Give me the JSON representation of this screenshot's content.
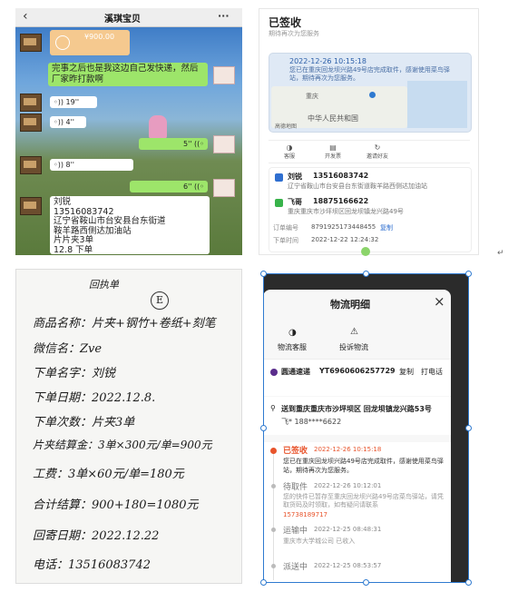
{
  "chat": {
    "title": "溪琪宝贝",
    "back_icon": "‹",
    "more_icon": "···",
    "payment_amount": "¥900.00",
    "msg_text": "完事之后也是我这边自己发快递，然后厂家昨打款啊",
    "voices": [
      {
        "duration": "19''",
        "side": "left"
      },
      {
        "duration": "4''",
        "side": "left"
      },
      {
        "duration": "5''",
        "side": "right"
      },
      {
        "duration": "8''",
        "side": "left"
      },
      {
        "duration": "6''",
        "side": "right"
      }
    ],
    "contact_name": "刘锐",
    "contact_phone": "13516083742",
    "contact_addr1": "辽宁省鞍山市台安县台东街道",
    "contact_addr2": "鞍羊路西侧达加油站",
    "contact_item": "片片夹3单",
    "contact_total": "12.8 下单"
  },
  "logistics": {
    "status": "已签收",
    "status_sub": "期待再次为您服务",
    "event_time": "2022-12-26 10:15:18",
    "event_text": "您已在重庆回龙坝兴路49号店完成取件，感谢使用菜鸟驿站，期待再次为您服务。",
    "map_label1": "重庆",
    "map_label2": "中华人民共和国",
    "map_credit": "高德地图",
    "actions": [
      "客服",
      "开发票",
      "邀请好友"
    ],
    "sender_name": "刘锐",
    "sender_phone": "13516083742",
    "sender_addr": "辽宁省鞍山市台安县台东街道鞍羊路西侧达加油站",
    "receiver_name": "飞哥",
    "receiver_phone": "18875166622",
    "receiver_addr": "重庆重庆市沙坪坝区回龙坝镇龙兴路49号",
    "order_label": "订单编号",
    "order_no": "8791925173448455",
    "copy_label": "复制",
    "time_label": "下单时间",
    "order_time": "2022-12-22 12:24:32"
  },
  "note": {
    "heading": "回执单",
    "circle": "E",
    "lines": [
      "商品名称：片夹+钢竹+卷纸+刻笔",
      "微信名：Zve",
      "下单名字：刘锐",
      "下单日期：2022.12.8.",
      "下单次数：片夹3单",
      "片夹结算金：3单×300元/单=900元",
      "工费：3单×60元/单=180元",
      "合计结算：900+180=1080元",
      "回寄日期：2022.12.22",
      "电话：13516083742"
    ]
  },
  "detail": {
    "title": "物流明细",
    "close_icon": "×",
    "service_label": "物流客服",
    "complain_label": "投诉物流",
    "courier": "圆通速递",
    "tracking_no": "YT6960606257729",
    "copy_label": "复制",
    "call_label": "打电话",
    "deliver_to": "送到重庆重庆市沙坪坝区 回龙坝镇龙兴路53号",
    "receiver": "飞* 188****6622",
    "events": [
      {
        "status": "已签收",
        "time": "2022-12-26 10:15:18",
        "text": "您已在重庆回龙坝兴路49号店完成取件，感谢使用菜鸟驿站，期待再次为您服务。",
        "active": true
      },
      {
        "status": "待取件",
        "time": "2022-12-26 10:12:01",
        "text": "您的快件已暂存至重庆回龙坝兴路49号店菜鸟驿站，请凭取货码及时领取，如有疑问请联系",
        "phone": "15738189717",
        "active": false
      },
      {
        "status": "运输中",
        "time": "2022-12-25 08:48:31",
        "text": "重庆市大学城公司 已收入",
        "active": false
      },
      {
        "status": "派送中",
        "time": "2022-12-25 08:53:57",
        "text": "",
        "active": false
      }
    ],
    "accent": "#e8542c",
    "link_color": "#e8542c"
  },
  "page": {
    "return_mark": "↵"
  }
}
